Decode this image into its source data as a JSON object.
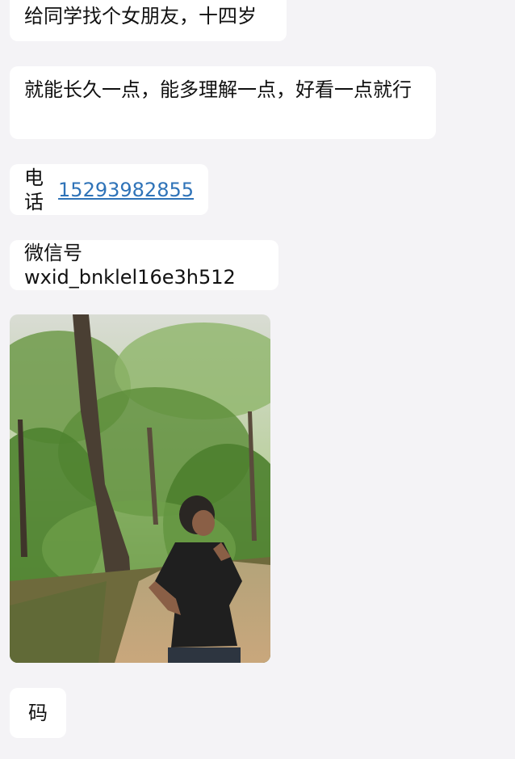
{
  "messages": [
    {
      "text": "给同学找个女朋友，十四岁"
    },
    {
      "text": "就能长久一点，能多理解一点，好看一点就行"
    },
    {
      "prefix": "电话",
      "link": "15293982855"
    },
    {
      "text": "微信号wxid_bnklel16e3h512"
    },
    {
      "text": "码"
    }
  ],
  "photo_message": {
    "description_icon": "photo-of-person-in-forest"
  },
  "colors": {
    "background": "#f4f3f6",
    "bubble": "#ffffff",
    "text": "#111111",
    "link": "#2f73b8"
  }
}
